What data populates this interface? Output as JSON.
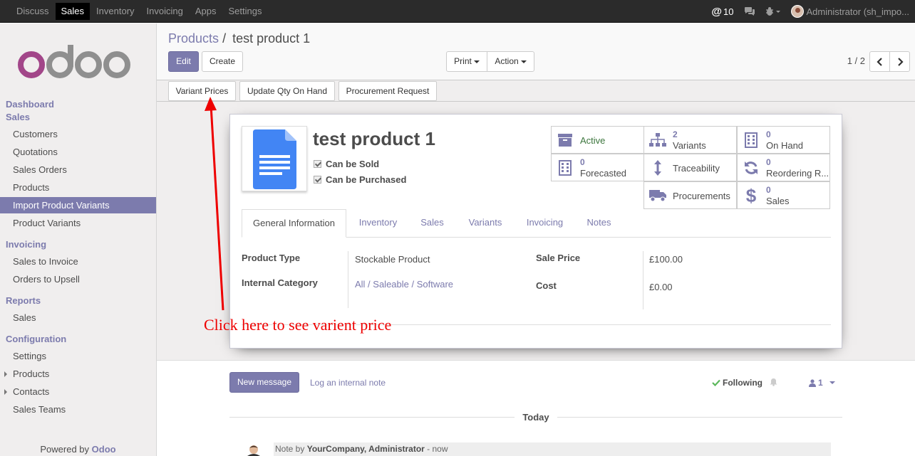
{
  "topbar": {
    "menu": [
      "Discuss",
      "Sales",
      "Inventory",
      "Invoicing",
      "Apps",
      "Settings"
    ],
    "active": "Sales",
    "messages_count": "10",
    "user": "Administrator (sh_impo..."
  },
  "sidebar": {
    "dashboard": "Dashboard",
    "sales_head": "Sales",
    "sales_items": [
      "Customers",
      "Quotations",
      "Sales Orders",
      "Products",
      "Import Product Variants",
      "Product Variants"
    ],
    "invoicing_head": "Invoicing",
    "invoicing_items": [
      "Sales to Invoice",
      "Orders to Upsell"
    ],
    "reports_head": "Reports",
    "reports_items": [
      "Sales"
    ],
    "config_head": "Configuration",
    "config_items": [
      "Settings",
      "Products",
      "Contacts",
      "Sales Teams"
    ],
    "powered_prefix": "Powered by",
    "powered_brand": "Odoo"
  },
  "control_panel": {
    "breadcrumb_parent": "Products",
    "breadcrumb_sep": "/",
    "breadcrumb_current": "test product 1",
    "edit": "Edit",
    "create": "Create",
    "print": "Print",
    "action": "Action",
    "pager": "1 / 2"
  },
  "statusbar": {
    "variant_prices": "Variant Prices",
    "update_qty": "Update Qty On Hand",
    "procurement": "Procurement Request"
  },
  "product": {
    "name": "test product 1",
    "can_be_sold": "Can be Sold",
    "can_be_purchased": "Can be Purchased"
  },
  "smart_buttons": {
    "active": "Active",
    "variants_num": "2",
    "variants": "Variants",
    "onhand_num": "0",
    "onhand": "On Hand",
    "forecasted_num": "0",
    "forecasted": "Forecasted",
    "traceability": "Traceability",
    "reordering_num": "0",
    "reordering": "Reordering R...",
    "procurements": "Procurements",
    "sales_num": "0",
    "sales": "Sales"
  },
  "tabs": [
    "General Information",
    "Inventory",
    "Sales",
    "Variants",
    "Invoicing",
    "Notes"
  ],
  "fields": {
    "product_type_label": "Product Type",
    "product_type": "Stockable Product",
    "internal_category_label": "Internal Category",
    "internal_category": "All / Saleable / Software",
    "sale_price_label": "Sale Price",
    "sale_price": "£100.00",
    "cost_label": "Cost",
    "cost": "£0.00"
  },
  "annotation": "Click here to see varient price",
  "chatter": {
    "new_message": "New message",
    "log_note": "Log an internal note",
    "following": "Following",
    "followers": "1",
    "today": "Today",
    "note_prefix": "Note by",
    "note_author": "YourCompany, Administrator",
    "note_suffix": "- now"
  },
  "colors": {
    "brand": "#7c7bad",
    "annotation": "#ee0000",
    "navbar": "#2b2b2b"
  }
}
